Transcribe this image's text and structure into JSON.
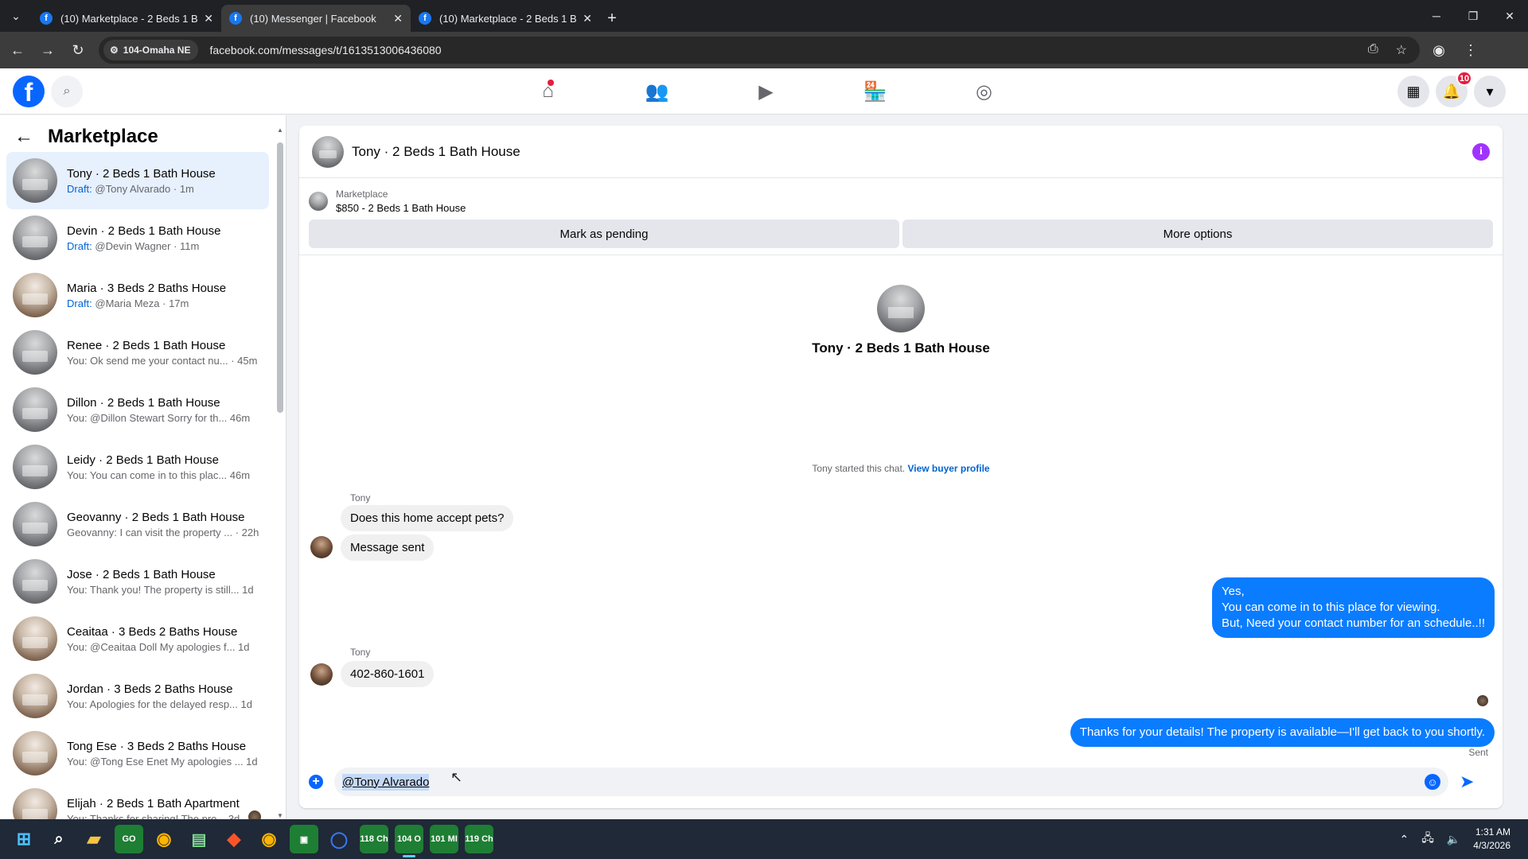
{
  "browser": {
    "tabs": [
      {
        "title": "(10) Marketplace - 2 Beds 1 Bat",
        "active": false
      },
      {
        "title": "(10) Messenger | Facebook",
        "active": true
      },
      {
        "title": "(10) Marketplace - 2 Beds 1 Bat",
        "active": false
      }
    ],
    "site_chip": "104-Omaha NE",
    "url": "facebook.com/messages/t/1613513006436080"
  },
  "fb_header": {
    "notification_count": "10",
    "nav": [
      "home-icon",
      "friends-icon",
      "video-icon",
      "marketplace-icon",
      "groups-icon"
    ]
  },
  "left_pane": {
    "title": "Marketplace",
    "conversations": [
      {
        "name": "Tony · 2 Beds 1 Bath House",
        "draft": "Draft:",
        "preview": " @Tony Alvarado · 1m",
        "selected": true,
        "thumb": "grey"
      },
      {
        "name": "Devin · 2 Beds 1 Bath House",
        "draft": "Draft:",
        "preview": " @Devin Wagner · 11m",
        "thumb": "grey"
      },
      {
        "name": "Maria · 3 Beds 2 Baths House",
        "draft": "Draft:",
        "preview": " @Maria Meza · 17m",
        "thumb": "brown"
      },
      {
        "name": "Renee · 2 Beds 1 Bath House",
        "draft": "",
        "preview": "You: Ok send me your contact nu... · 45m",
        "thumb": "grey"
      },
      {
        "name": "Dillon · 2 Beds 1 Bath House",
        "draft": "",
        "preview": "You: @Dillon Stewart Sorry for th...  46m",
        "thumb": "grey"
      },
      {
        "name": "Leidy · 2 Beds 1 Bath House",
        "draft": "",
        "preview": "You: You can come in to this plac...  46m",
        "thumb": "grey"
      },
      {
        "name": "Geovanny · 2 Beds 1 Bath House",
        "draft": "",
        "preview": "Geovanny: I can visit the property ... · 22h",
        "thumb": "grey"
      },
      {
        "name": "Jose · 2 Beds 1 Bath House",
        "draft": "",
        "preview": "You: Thank you! The property is still... 1d",
        "thumb": "grey"
      },
      {
        "name": "Ceaitaa · 3 Beds 2 Baths House",
        "draft": "",
        "preview": "You: @Ceaitaa Doll My apologies f...  1d",
        "thumb": "brown"
      },
      {
        "name": "Jordan · 3 Beds 2 Baths House",
        "draft": "",
        "preview": "You: Apologies for the delayed resp...  1d",
        "thumb": "brown"
      },
      {
        "name": "Tong Ese · 3 Beds 2 Baths House",
        "draft": "",
        "preview": "You: @Tong Ese Enet My apologies ...  1d",
        "thumb": "brown"
      },
      {
        "name": "Elijah · 2 Beds 1 Bath Apartment",
        "draft": "",
        "preview": "You: Thanks for sharing! The pro... 3d",
        "thumb": "brown"
      }
    ]
  },
  "chat": {
    "title": "Tony · 2 Beds 1 Bath House",
    "listing_category": "Marketplace",
    "listing_title": "$850 - 2 Beds 1 Bath House",
    "mark_pending": "Mark as pending",
    "more_options": "More options",
    "hero_name": "Tony · 2 Beds 1 Bath House",
    "started_text": "Tony started this chat. ",
    "view_profile": "View buyer profile",
    "sender_1": "Tony",
    "msg_1": "Does this home accept pets?",
    "msg_2": "Message sent",
    "reply_1_line1": "Yes,",
    "reply_1_line2": "You can come in to this place for viewing.",
    "reply_1_line3": "But, Need your contact number for an schedule..!!",
    "sender_2": "Tony",
    "msg_3": "402-860-1601",
    "reply_2": "Thanks for your details! The property is available—I'll get back to you shortly.",
    "sent_label": "Sent",
    "composer_value": "@Tony Alvarado"
  },
  "taskbar": {
    "apps": [
      "GO",
      "118 Ch",
      "104 O",
      "101 MI",
      "119 Ch"
    ],
    "time": "1:31 AM",
    "date": "4/3/2026"
  },
  "colors": {
    "accent": "#0866ff",
    "outgoing_bubble": "#0a7cff",
    "selected_row": "#e7f0fd",
    "draft_text": "#0064d1"
  }
}
